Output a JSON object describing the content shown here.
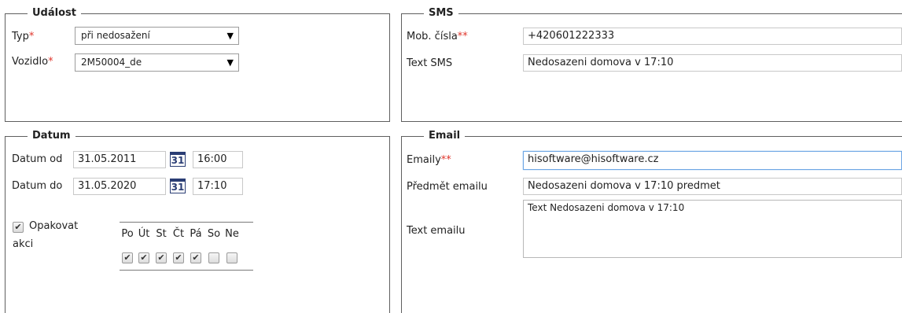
{
  "udalost": {
    "legend": "Událost",
    "typ_label": "Typ",
    "typ_value": "při nedosažení",
    "vozidlo_label": "Vozidlo",
    "vozidlo_value": "2M50004_de",
    "required_mark": "*"
  },
  "sms": {
    "legend": "SMS",
    "phone_label": "Mob. čísla",
    "phone_required": "**",
    "phone_value": "+420601222333",
    "text_label": "Text SMS",
    "text_value": "Nedosazeni domova v 17:10"
  },
  "datum": {
    "legend": "Datum",
    "od_label": "Datum od",
    "od_date": "31.05.2011",
    "od_time": "16:00",
    "do_label": "Datum do",
    "do_date": "31.05.2020",
    "do_time": "17:10",
    "calendar_number": "31",
    "repeat_label_1": "Opakovat",
    "repeat_label_2": "akci",
    "repeat_checked": true,
    "days": [
      "Po",
      "Út",
      "St",
      "Čt",
      "Pá",
      "So",
      "Ne"
    ],
    "days_checked": [
      true,
      true,
      true,
      true,
      true,
      false,
      false
    ],
    "checkmark": "✔"
  },
  "email": {
    "legend": "Email",
    "emails_label": "Emaily",
    "emails_required": "**",
    "emails_value": "hisoftware@hisoftware.cz",
    "subject_label": "Předmět emailu",
    "subject_value": "Nedosazeni domova v 17:10 predmet",
    "body_label": "Text emailu",
    "body_value": "Text Nedosazeni domova v 17:10"
  },
  "icons": {
    "dropdown": "▼"
  }
}
